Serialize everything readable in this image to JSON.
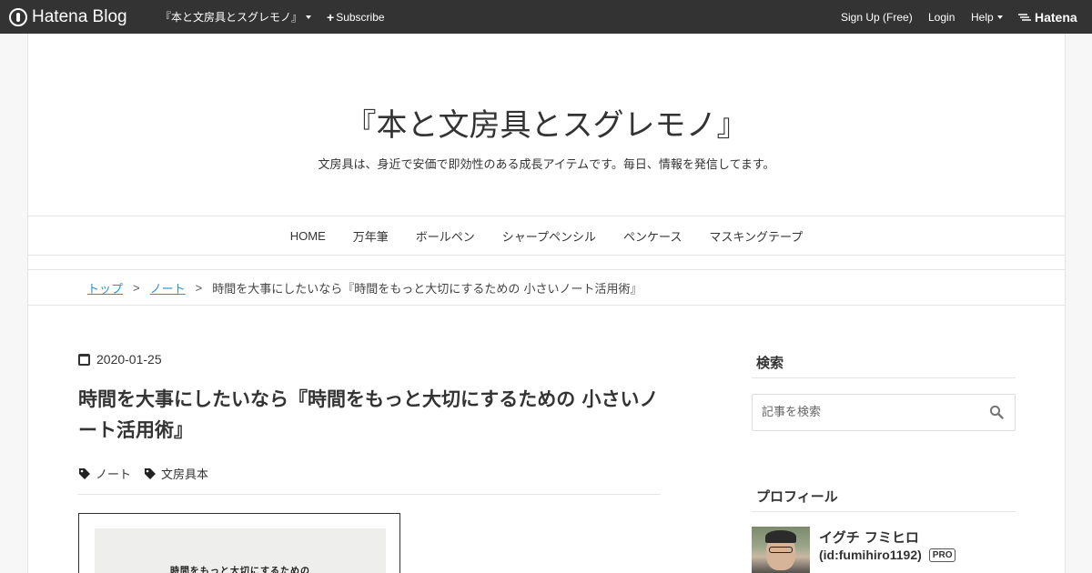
{
  "topbar": {
    "brand": "Hatena Blog",
    "blog_menu": "『本と文房具とスグレモノ』",
    "subscribe": "Subscribe",
    "signup": "Sign Up (Free)",
    "login": "Login",
    "help": "Help",
    "hatena": "Hatena"
  },
  "header": {
    "title": "『本と文房具とスグレモノ』",
    "description": "文房具は、身近で安価で即効性のある成長アイテムです。毎日、情報を発信してます。"
  },
  "nav": {
    "items": [
      {
        "label": "HOME"
      },
      {
        "label": "万年筆"
      },
      {
        "label": "ボールペン"
      },
      {
        "label": "シャープペンシル"
      },
      {
        "label": "ペンケース"
      },
      {
        "label": "マスキングテープ"
      }
    ]
  },
  "breadcrumb": {
    "top": "トップ",
    "sep": ">",
    "category": "ノート",
    "current": "時間を大事にしたいなら『時間をもっと大切にするための 小さいノート活用術』"
  },
  "article": {
    "date": "2020-01-25",
    "title": "時間を大事にしたいなら『時間をもっと大切にするための 小さいノート活用術』",
    "tags": [
      "ノート",
      "文房具本"
    ],
    "image_text": "時間をもっと大切にするための"
  },
  "sidebar": {
    "search": {
      "heading": "検索",
      "placeholder": "記事を検索"
    },
    "profile": {
      "heading": "プロフィール",
      "name": "イグチ フミヒロ",
      "id": "(id:fumihiro1192)",
      "badge": "PRO"
    }
  },
  "colors": {
    "topbar": "#333333",
    "link": "#2a8fcc",
    "background": "#f7f7f7"
  }
}
